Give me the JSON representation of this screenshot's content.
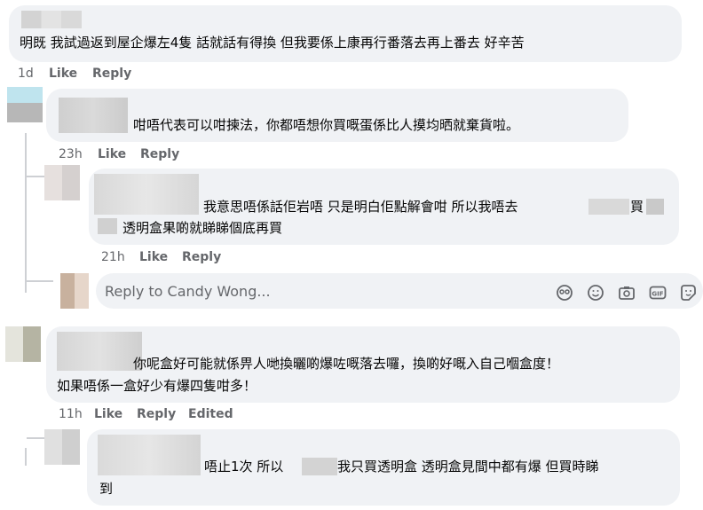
{
  "comments": [
    {
      "text_lines": [
        "明既 我試過返到屋企爆左4隻 話就話有得換 但我要係上康再行番落去再上番去 好辛苦"
      ],
      "time": "1d",
      "like": "Like",
      "reply": "Reply"
    },
    {
      "text_lines": [
        "咁唔代表可以咁揀法，你都唔想你買嘅蛋係比人摸均晒就棄貨啦。"
      ],
      "time": "23h",
      "like": "Like",
      "reply": "Reply"
    },
    {
      "text_lines": [
        "我意思唔係話佢岩唔 只是明白佢點解會咁 所以我唔去",
        "買",
        "透明盒果啲就睇睇個底再買"
      ],
      "time": "21h",
      "like": "Like",
      "reply": "Reply"
    },
    {
      "text_lines": [
        "你呢盒好可能就係畀人哋換曬啲爆咗嘅落去囉，換啲好嘅入自己嗰盒度！",
        "如果唔係一盒好少有爆四隻咁多！"
      ],
      "time": "11h",
      "like": "Like",
      "reply": "Reply",
      "edited": "Edited"
    },
    {
      "text_lines": [
        "唔止1次 所以",
        "我只買透明盒 透明盒見間中都有爆 但買時睇",
        "到"
      ]
    }
  ],
  "reply_box": {
    "placeholder": "Reply to Candy Wong..."
  },
  "icons": [
    "sticker-face-icon",
    "emoji-icon",
    "camera-icon",
    "gif-icon",
    "sticker-icon"
  ]
}
